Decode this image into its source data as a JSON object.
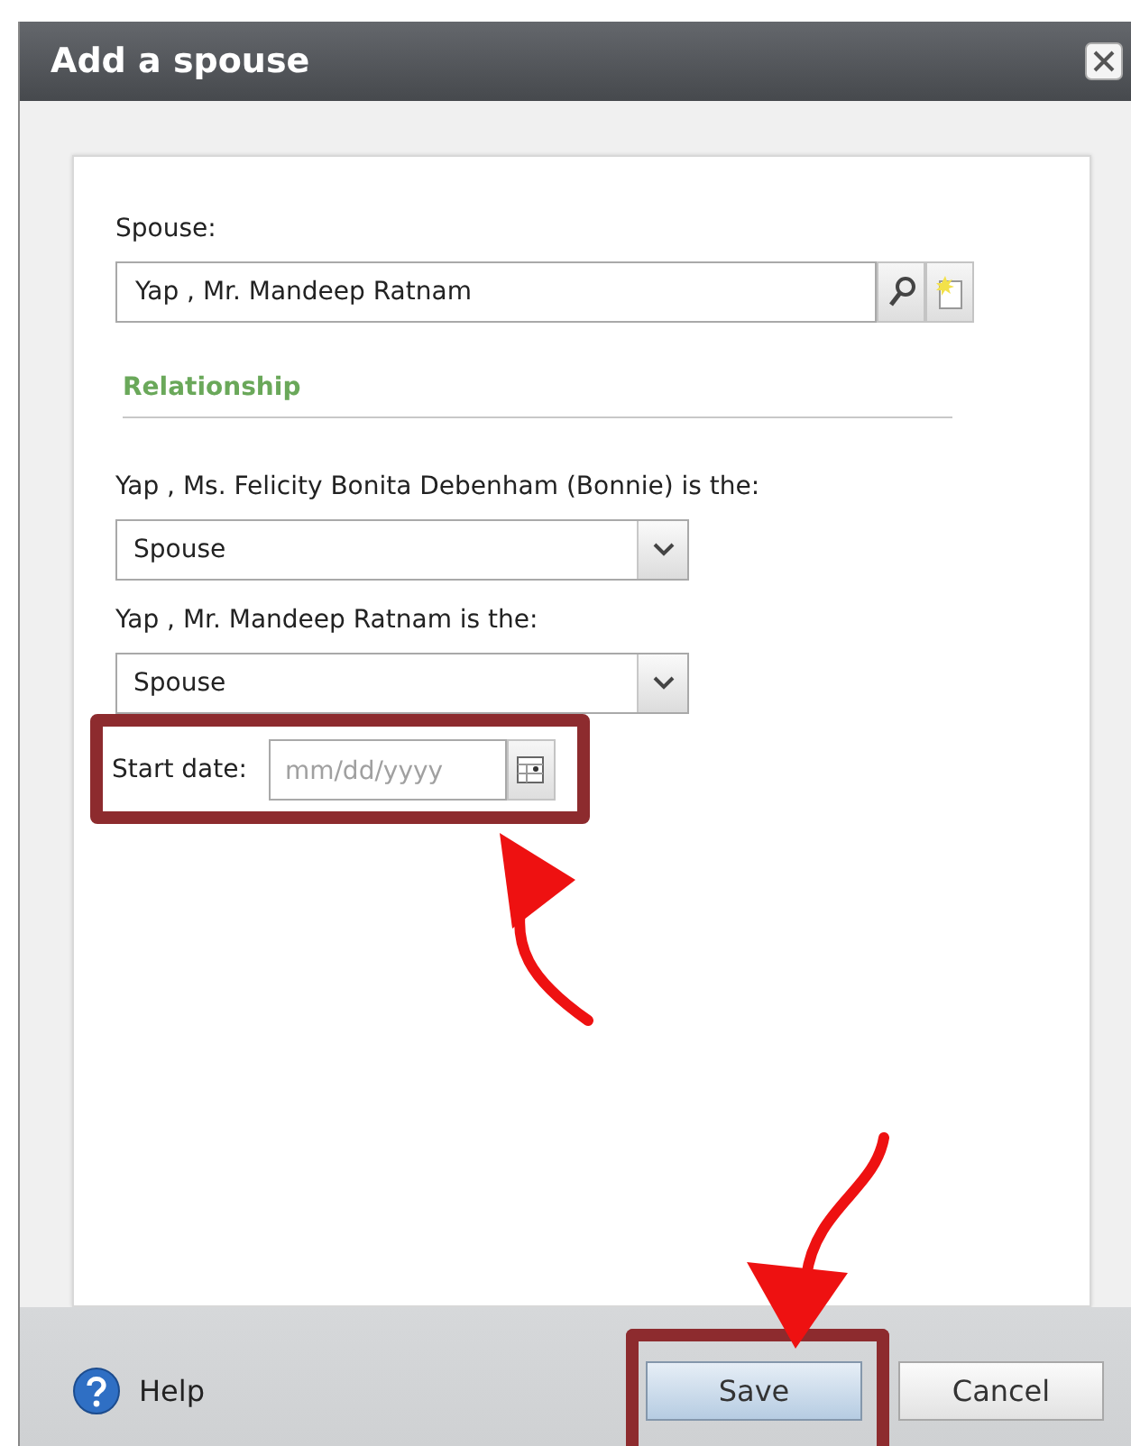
{
  "window": {
    "title": "Add a spouse"
  },
  "spouse": {
    "label": "Spouse:",
    "value": "Yap , Mr. Mandeep Ratnam"
  },
  "section": {
    "title": "Relationship"
  },
  "relationships": [
    {
      "label": "Yap , Ms. Felicity Bonita Debenham (Bonnie) is the:",
      "value": "Spouse"
    },
    {
      "label": "Yap , Mr. Mandeep Ratnam is the:",
      "value": "Spouse"
    }
  ],
  "start_date": {
    "label": "Start date:",
    "placeholder": "mm/dd/yyyy",
    "highlighted": true
  },
  "footer": {
    "help": "Help",
    "buttons": [
      {
        "label": "Save",
        "kind": "primary",
        "highlighted": true
      },
      {
        "label": "Cancel",
        "kind": "secondary",
        "highlighted": false
      }
    ]
  }
}
